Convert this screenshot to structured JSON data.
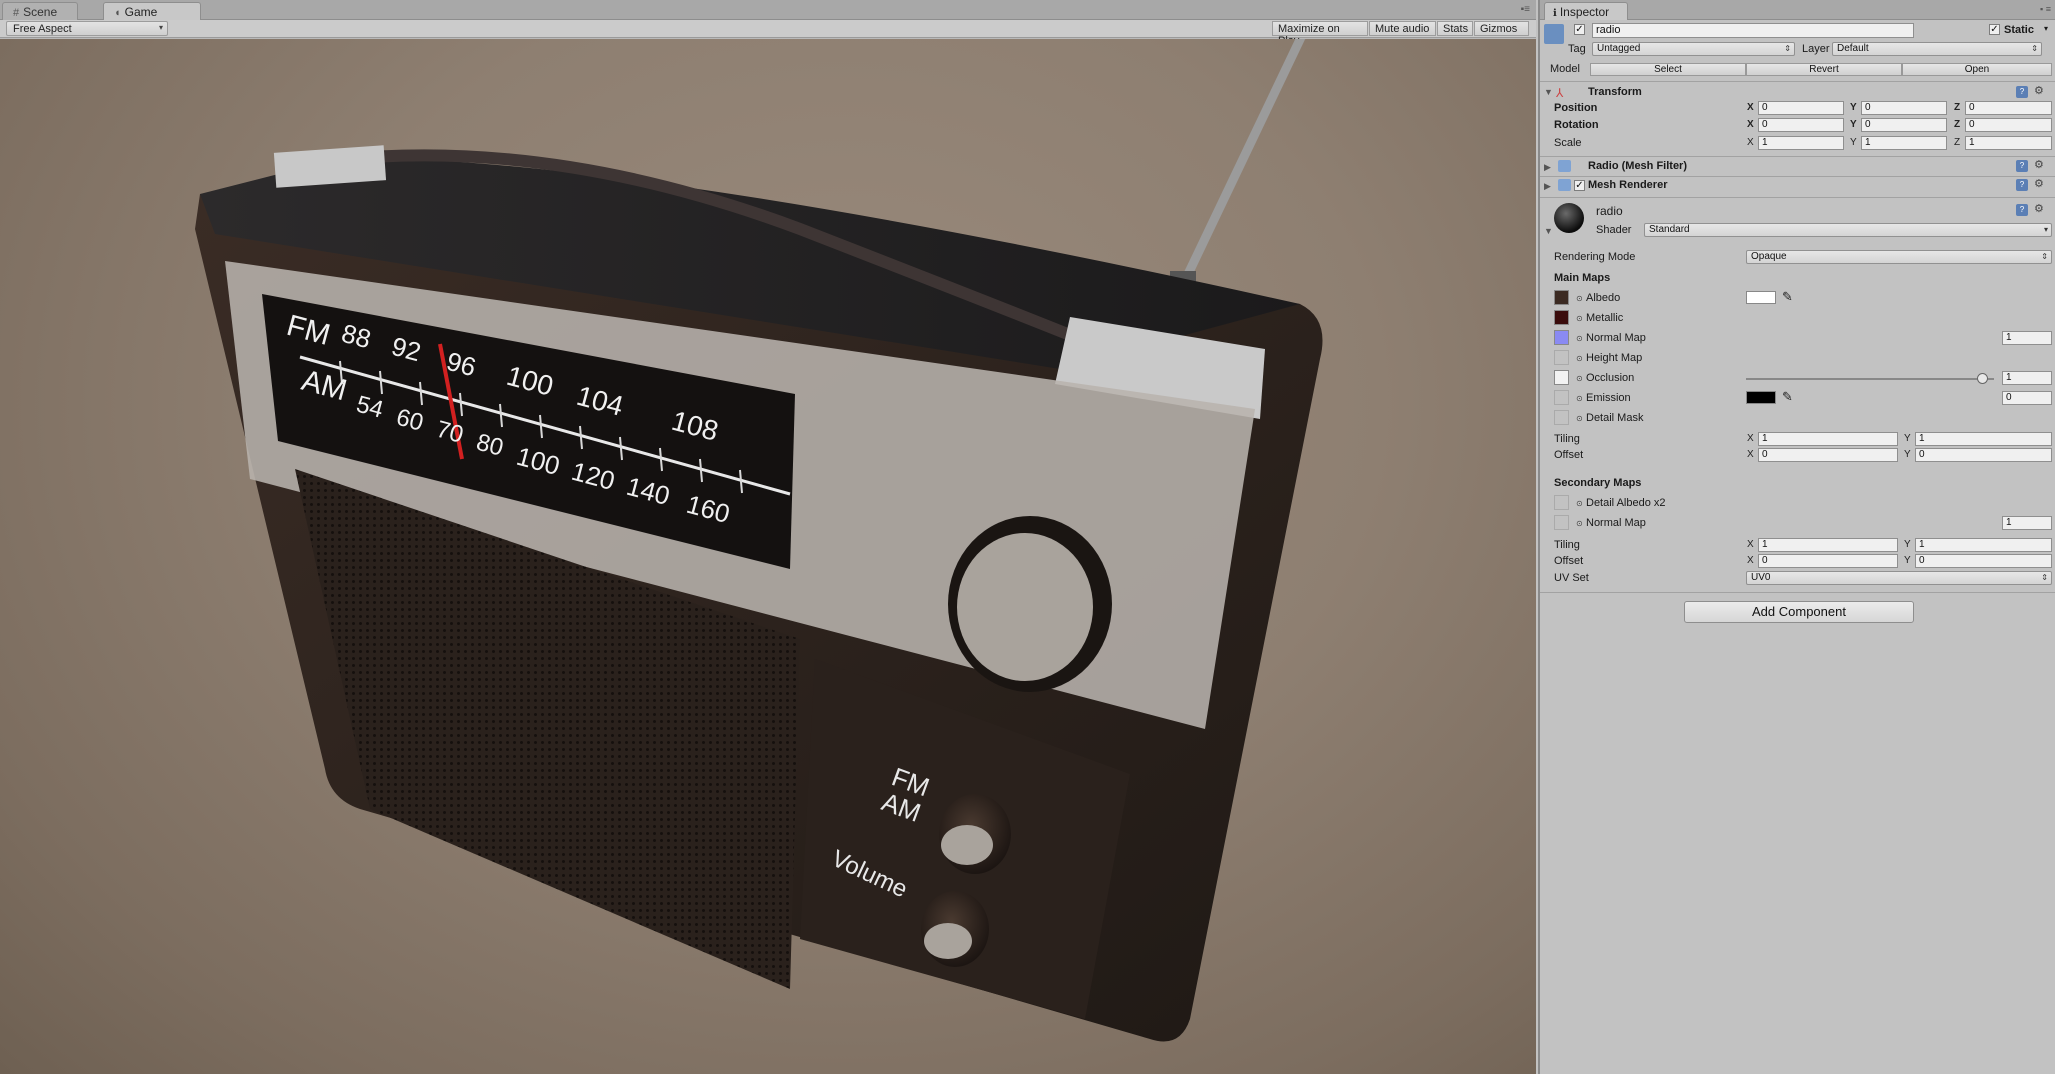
{
  "game_panel": {
    "tabs": [
      {
        "label": "Scene",
        "icon": "scene-grid-icon"
      },
      {
        "label": "Game",
        "icon": "game-pacman-icon"
      }
    ],
    "aspect_dropdown": "Free Aspect",
    "toolbar_buttons": [
      "Maximize on Play",
      "Mute audio",
      "Stats",
      "Gizmos"
    ],
    "radio": {
      "fm_label": "FM",
      "am_label": "AM",
      "fm_scale": [
        "88",
        "92",
        "96",
        "100",
        "104",
        "108"
      ],
      "am_scale": [
        "54",
        "60",
        "70",
        "80",
        "100",
        "120",
        "140",
        "160"
      ],
      "switch_fm": "FM",
      "switch_am": "AM",
      "volume_label": "Volume"
    }
  },
  "inspector": {
    "tab_label": "Inspector",
    "object": {
      "name": "radio",
      "static_label": "Static",
      "tag_label": "Tag",
      "tag_value": "Untagged",
      "layer_label": "Layer",
      "layer_value": "Default",
      "model_label": "Model",
      "model_buttons": [
        "Select",
        "Revert",
        "Open"
      ]
    },
    "transform": {
      "title": "Transform",
      "rows": [
        {
          "label": "Position",
          "x": "0",
          "y": "0",
          "z": "0"
        },
        {
          "label": "Rotation",
          "x": "0",
          "y": "0",
          "z": "0"
        },
        {
          "label": "Scale",
          "x": "1",
          "y": "1",
          "z": "1"
        }
      ]
    },
    "mesh_filter": {
      "title": "Radio (Mesh Filter)"
    },
    "mesh_renderer": {
      "title": "Mesh Renderer"
    },
    "material": {
      "name": "radio",
      "shader_label": "Shader",
      "shader_value": "Standard",
      "rendering_mode_label": "Rendering Mode",
      "rendering_mode_value": "Opaque",
      "main_maps_title": "Main Maps",
      "maps": [
        {
          "label": "Albedo",
          "swatch": "#3b2a22"
        },
        {
          "label": "Metallic",
          "swatch": "#3a0c0c"
        },
        {
          "label": "Normal Map",
          "swatch": "#8a8af2",
          "value": "1"
        },
        {
          "label": "Height Map",
          "swatch": "#c2c2c2"
        },
        {
          "label": "Occlusion",
          "swatch": "#f2f2f2",
          "value": "1"
        },
        {
          "label": "Emission",
          "swatch": "#c2c2c2",
          "value": "0"
        },
        {
          "label": "Detail Mask",
          "swatch": "#c2c2c2"
        }
      ],
      "tiling_label": "Tiling",
      "offset_label": "Offset",
      "main_tiling": {
        "x": "1",
        "y": "1"
      },
      "main_offset": {
        "x": "0",
        "y": "0"
      },
      "secondary_maps_title": "Secondary Maps",
      "secondary_maps": [
        {
          "label": "Detail Albedo x2"
        },
        {
          "label": "Normal Map",
          "value": "1"
        }
      ],
      "secondary_tiling": {
        "x": "1",
        "y": "1"
      },
      "secondary_offset": {
        "x": "0",
        "y": "0"
      },
      "uv_set_label": "UV Set",
      "uv_set_value": "UV0",
      "occlusion_level": 0.95
    },
    "add_component_label": "Add Component",
    "axis_labels": {
      "x": "X",
      "y": "Y",
      "z": "Z"
    }
  },
  "colors": {
    "albedo_swatch_color": "#ffffff",
    "emission_swatch_color": "#000000",
    "normal_map_tex": "#8a8af2"
  }
}
